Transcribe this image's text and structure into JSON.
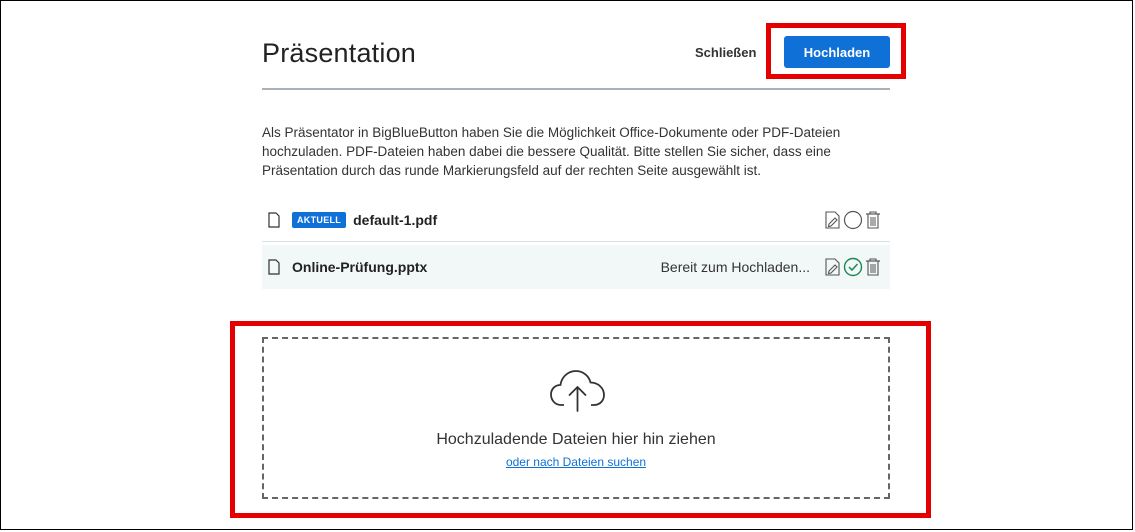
{
  "modal": {
    "title": "Präsentation",
    "close_label": "Schließen",
    "upload_label": "Hochladen",
    "description": "Als Präsentator in BigBlueButton haben Sie die Möglichkeit Office-Dokumente oder PDF-Dateien hochzuladen. PDF-Dateien haben dabei die bessere Qualität. Bitte stellen Sie sicher, dass eine Präsentation durch das runde Markierungsfeld auf der rechten Seite ausgewählt ist."
  },
  "files": [
    {
      "badge": "AKTUELL",
      "name": "default-1.pdf",
      "status": "",
      "selected": false
    },
    {
      "badge": "",
      "name": "Online-Prüfung.pptx",
      "status": "Bereit zum Hochladen...",
      "selected": true
    }
  ],
  "dropzone": {
    "message": "Hochzuladende Dateien hier hin ziehen",
    "browse_link": "oder nach Dateien suchen"
  },
  "colors": {
    "accent": "#0f70d7",
    "highlight": "#e40000",
    "selected_check": "#1a8a52"
  },
  "icons": [
    "document-icon",
    "edit-download-icon",
    "select-circle-icon",
    "check-circle-icon",
    "trash-icon",
    "cloud-upload-icon"
  ]
}
